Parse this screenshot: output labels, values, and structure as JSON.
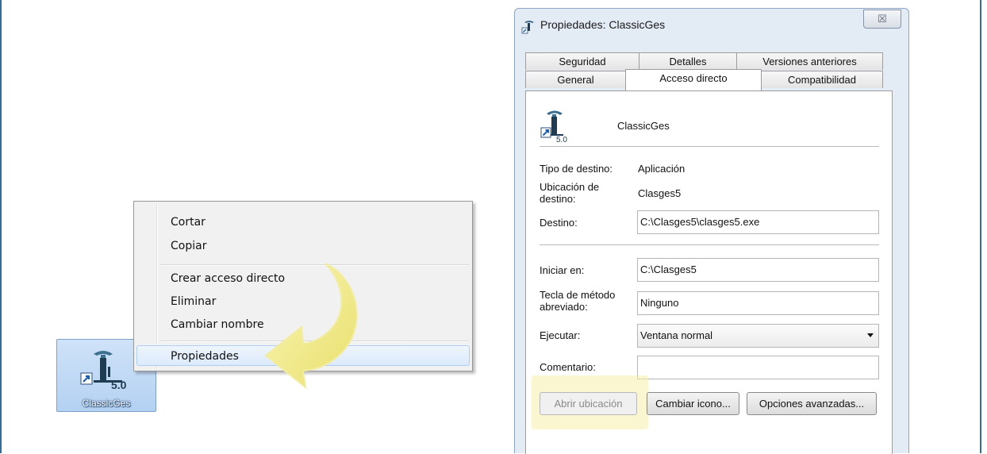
{
  "desktop_icon": {
    "label": "ClassicGes",
    "version_badge": "5.0",
    "icon": "shortcut-arrow-icon"
  },
  "context_menu": {
    "items": [
      {
        "label": "Cortar"
      },
      {
        "label": "Copiar"
      },
      {
        "label": "Crear acceso directo"
      },
      {
        "label": "Eliminar"
      },
      {
        "label": "Cambiar nombre"
      },
      {
        "label": "Propiedades"
      }
    ],
    "highlighted": "Propiedades"
  },
  "dialog": {
    "title": "Propiedades: ClassicGes",
    "close_glyph": "☒",
    "tabs_row1": [
      "Seguridad",
      "Detalles",
      "Versiones anteriores"
    ],
    "tabs_row2": [
      "General",
      "Acceso directo",
      "Compatibilidad"
    ],
    "active_tab": "Acceso directo",
    "app_name": "ClassicGes",
    "app_version": "5.0",
    "fields": {
      "tipo_label": "Tipo de destino:",
      "tipo_value": "Aplicación",
      "ubicacion_label_1": "Ubicación de",
      "ubicacion_label_2": "destino:",
      "ubicacion_value": "Clasges5",
      "destino_label": "Destino:",
      "destino_value": "C:\\Clasges5\\clasges5.exe",
      "iniciar_label": "Iniciar en:",
      "iniciar_value": "C:\\Clasges5",
      "tecla_label_1": "Tecla de método",
      "tecla_label_2": "abreviado:",
      "tecla_value": "Ninguno",
      "ejecutar_label": "Ejecutar:",
      "ejecutar_value": "Ventana normal",
      "comentario_label": "Comentario:",
      "comentario_value": ""
    },
    "buttons": {
      "abrir": "Abrir ubicación",
      "cambiar_icono": "Cambiar icono...",
      "opciones": "Opciones avanzadas..."
    }
  },
  "colors": {
    "frame_border": "#2e6da4",
    "highlight_yellow": "#f5eeaa",
    "menu_highlight": "#dbeafb"
  }
}
